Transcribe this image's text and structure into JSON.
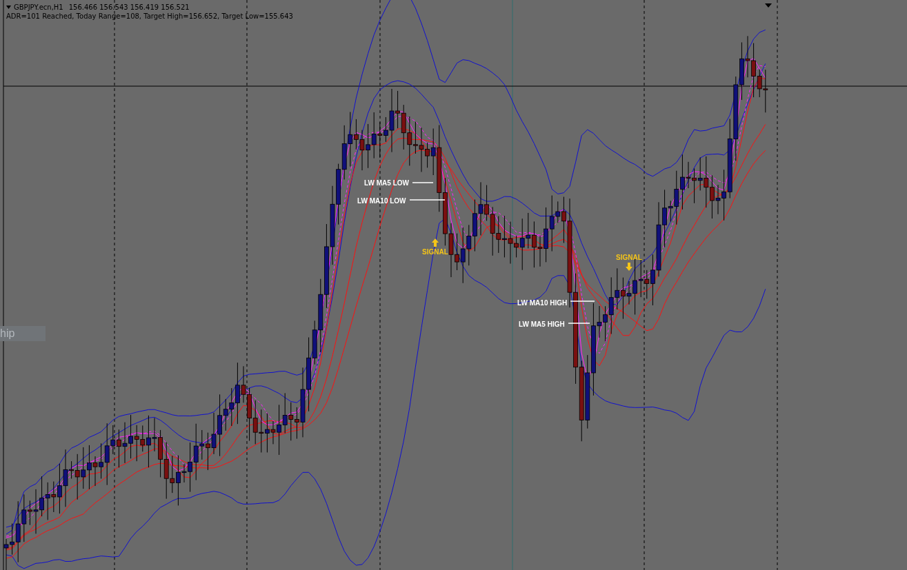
{
  "chart_header": {
    "symbol": "GBPJPY.ecn,H1",
    "prices": "156.466 156.543 156.419 156.521",
    "indicator_text": "ADR=101 Reached, Today Range=108, Target High=156.652, Target Low=155.643"
  },
  "annotations": [
    {
      "kind": "label",
      "text": "LW MA5 LOW"
    },
    {
      "kind": "label",
      "text": "LW MA10 LOW"
    },
    {
      "kind": "signal_up",
      "text": "SIGNAL"
    },
    {
      "kind": "signal_down",
      "text": "SIGNAL"
    },
    {
      "kind": "label",
      "text": "LW MA10 HIGH"
    },
    {
      "kind": "label",
      "text": "LW MA5 HIGH"
    }
  ],
  "overlay_tab": {
    "text": "hip"
  }
}
